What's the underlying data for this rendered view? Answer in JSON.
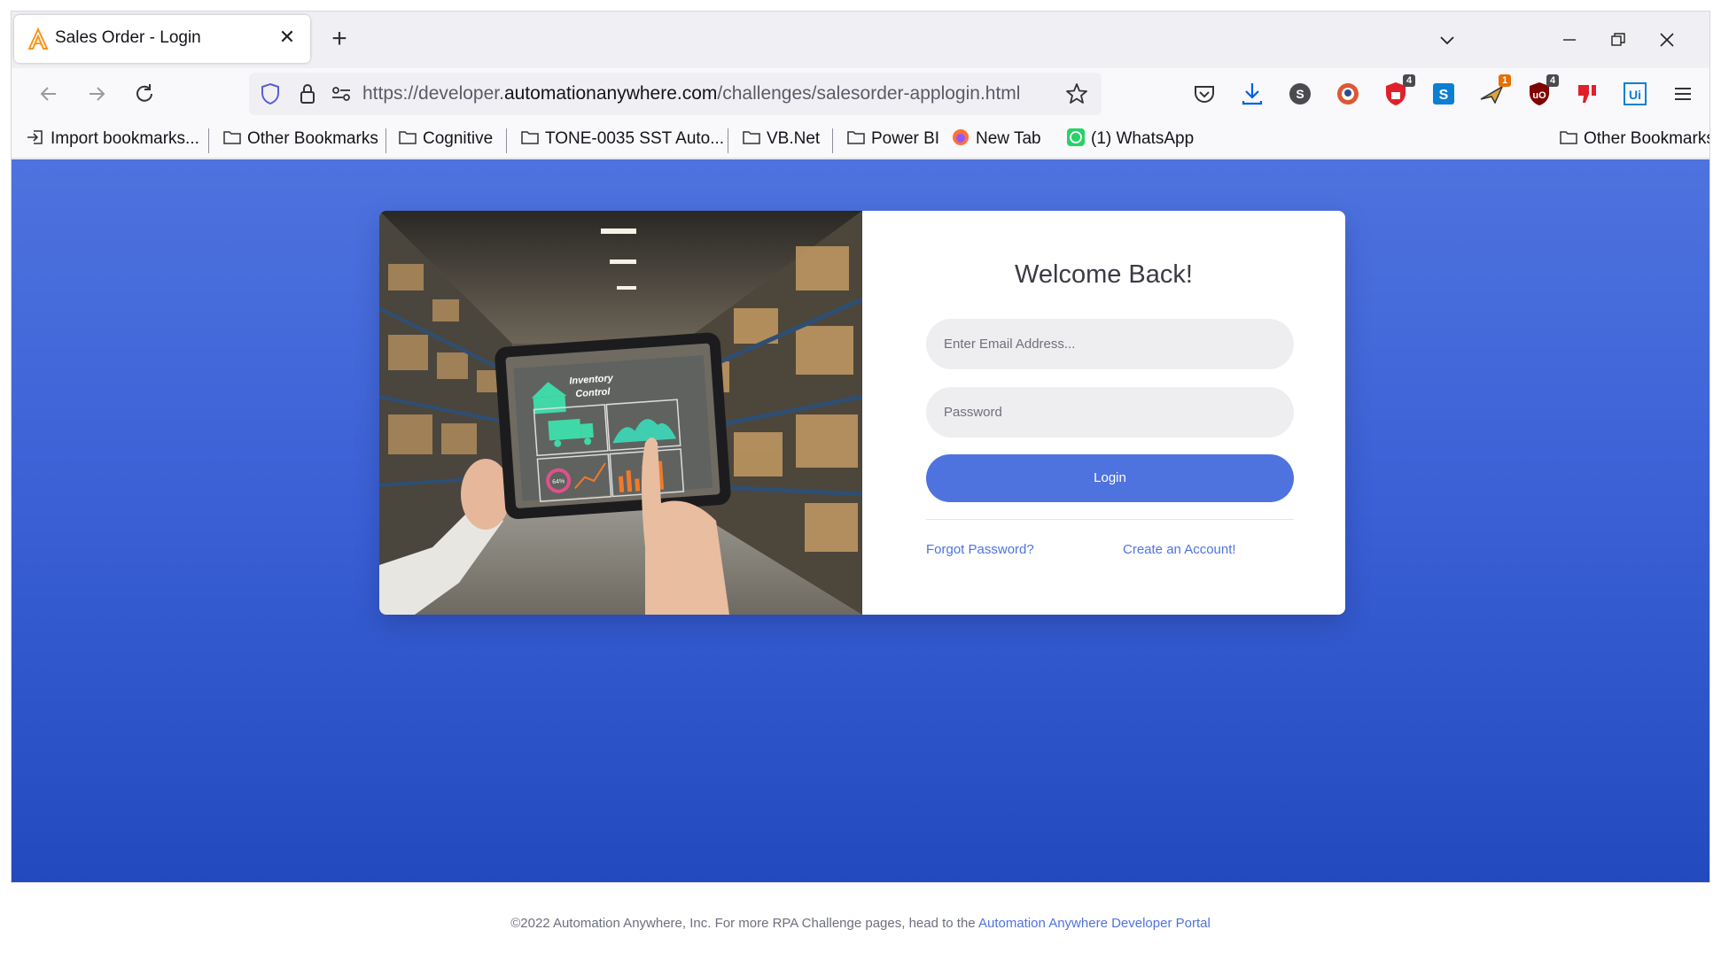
{
  "browser": {
    "tab": {
      "title": "Sales Order - Login"
    },
    "url": {
      "prefix": "https://developer.",
      "domain": "automationanywhere.com",
      "path": "/challenges/salesorder-applogin.html"
    },
    "extensions": [
      {
        "name": "pocket-icon"
      },
      {
        "name": "download-icon"
      },
      {
        "name": "s-circle-icon",
        "label": "S"
      },
      {
        "name": "duckduckgo-icon"
      },
      {
        "name": "ublock-shield-icon",
        "badge": "4"
      },
      {
        "name": "s-square-icon",
        "label": "S"
      },
      {
        "name": "plane-icon",
        "badge": "1"
      },
      {
        "name": "ublock-origin-icon",
        "badge": "4"
      },
      {
        "name": "red-thumb-icon"
      },
      {
        "name": "uipath-icon",
        "label": "Ui"
      }
    ],
    "bookmarks": {
      "import": "Import bookmarks...",
      "other1": "Other Bookmarks",
      "cognitive": "Cognitive",
      "tone": "TONE-0035 SST Auto...",
      "vbnet": "VB.Net",
      "powerbi": "Power BI",
      "newtab": "New Tab",
      "whatsapp": "(1) WhatsApp",
      "other2": "Other Bookmarks"
    }
  },
  "login": {
    "heading": "Welcome Back!",
    "email_placeholder": "Enter Email Address...",
    "password_placeholder": "Password",
    "login_label": "Login",
    "forgot_link": "Forgot Password?",
    "create_link": "Create an Account!"
  },
  "image": {
    "title_line1": "Inventory",
    "title_line2": "Control",
    "percent": "64%"
  },
  "footer": {
    "text": "©2022 Automation Anywhere, Inc. For more RPA Challenge pages, head to the ",
    "link": "Automation Anywhere Developer Portal"
  },
  "colors": {
    "primary": "#4e73df",
    "gradient_end": "#224abe"
  }
}
